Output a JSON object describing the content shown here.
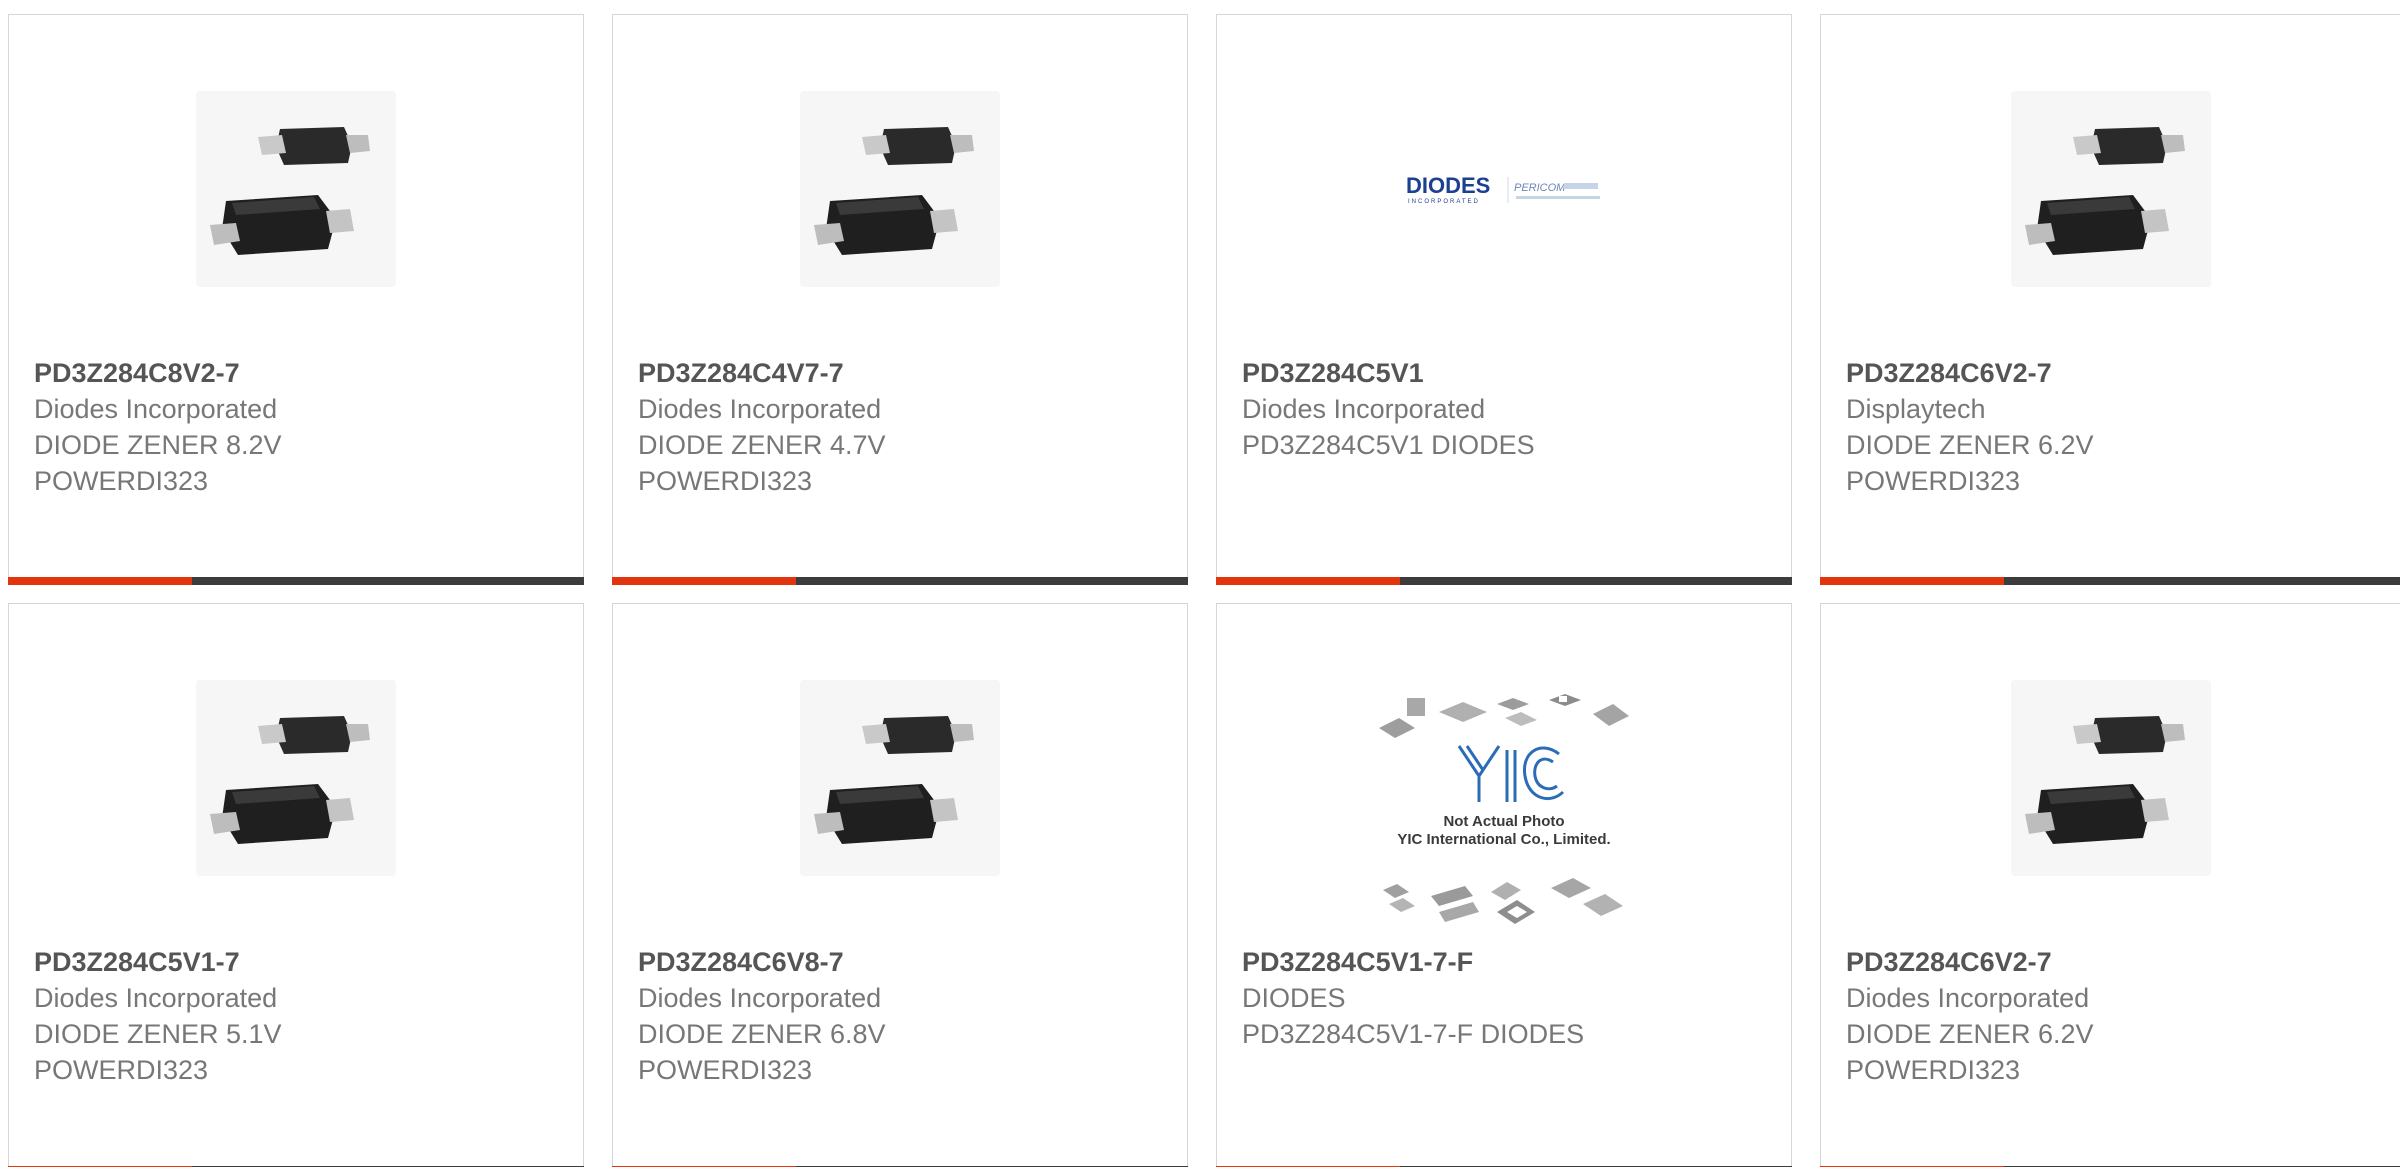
{
  "products": [
    {
      "part_number": "PD3Z284C8V2-7",
      "manufacturer": "Diodes Incorporated",
      "description_lines": [
        "DIODE ZENER 8.2V",
        "POWERDI323"
      ],
      "image": "diode-package-photo"
    },
    {
      "part_number": "PD3Z284C4V7-7",
      "manufacturer": "Diodes Incorporated",
      "description_lines": [
        "DIODE ZENER 4.7V",
        "POWERDI323"
      ],
      "image": "diode-package-photo"
    },
    {
      "part_number": "PD3Z284C5V1",
      "manufacturer": "Diodes Incorporated",
      "description_lines": [
        "PD3Z284C5V1 DIODES"
      ],
      "image": "diodes-pericom-logo",
      "logo_text": {
        "brand": "DIODES",
        "sub": "INCORPORATED",
        "partner": "PERICOM"
      }
    },
    {
      "part_number": "PD3Z284C6V2-7",
      "manufacturer": "Displaytech",
      "description_lines": [
        "DIODE ZENER 6.2V",
        "POWERDI323"
      ],
      "image": "diode-package-photo"
    },
    {
      "part_number": "PD3Z284C5V1-7",
      "manufacturer": "Diodes Incorporated",
      "description_lines": [
        "DIODE ZENER 5.1V",
        "POWERDI323"
      ],
      "image": "diode-package-photo"
    },
    {
      "part_number": "PD3Z284C6V8-7",
      "manufacturer": "Diodes Incorporated",
      "description_lines": [
        "DIODE ZENER 6.8V",
        "POWERDI323"
      ],
      "image": "diode-package-photo"
    },
    {
      "part_number": "PD3Z284C5V1-7-F",
      "manufacturer": "DIODES",
      "description_lines": [
        "PD3Z284C5V1-7-F DIODES"
      ],
      "image": "yic-not-actual-photo",
      "placeholder_text": {
        "line1": "Not Actual Photo",
        "line2": "YIC International Co., Limited."
      }
    },
    {
      "part_number": "PD3Z284C6V2-7",
      "manufacturer": "Diodes Incorporated",
      "description_lines": [
        "DIODE ZENER 6.2V",
        "POWERDI323"
      ],
      "image": "diode-package-photo"
    }
  ],
  "colors": {
    "accent": "#e2350d",
    "bar": "#3c3c3c",
    "part_number": "#555555",
    "text": "#777777",
    "border": "#d6d6d6"
  }
}
